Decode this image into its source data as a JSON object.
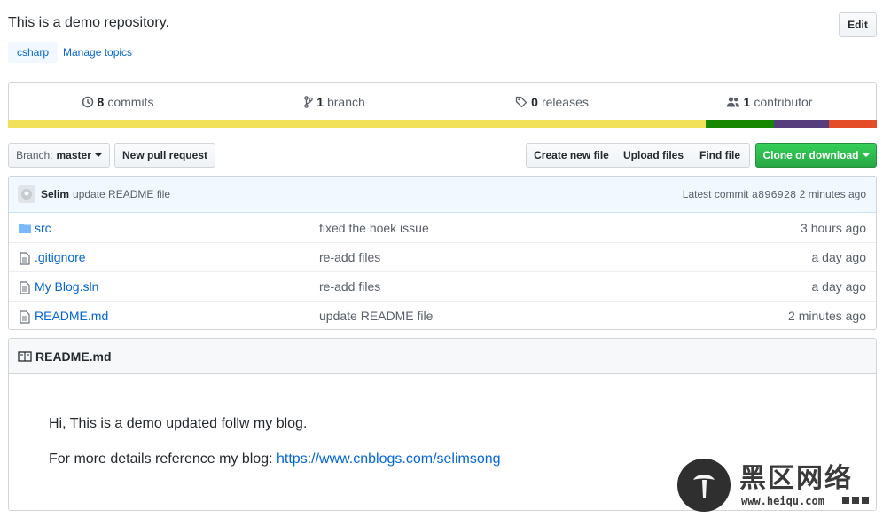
{
  "repo": {
    "description": "This is a demo repository.",
    "edit_label": "Edit",
    "topics": [
      "csharp"
    ],
    "manage_topics_label": "Manage topics"
  },
  "summary": {
    "commits": {
      "count": "8",
      "label": "commits",
      "icon": "history-icon"
    },
    "branches": {
      "count": "1",
      "label": "branch",
      "icon": "branch-icon"
    },
    "releases": {
      "count": "0",
      "label": "releases",
      "icon": "tag-icon"
    },
    "contributors": {
      "count": "1",
      "label": "contributor",
      "icon": "people-icon"
    }
  },
  "languages": [
    {
      "color": "#f1e05a",
      "percent": 80.3
    },
    {
      "color": "#178600",
      "percent": 7.9
    },
    {
      "color": "#563d7c",
      "percent": 6.3
    },
    {
      "color": "#e34c26",
      "percent": 5.5
    }
  ],
  "toolbar": {
    "branch_prefix": "Branch:",
    "branch_name": "master",
    "new_pr_label": "New pull request",
    "create_file_label": "Create new file",
    "upload_files_label": "Upload files",
    "find_file_label": "Find file",
    "clone_label": "Clone or download"
  },
  "latest_commit": {
    "author": "Selim",
    "message": "update README file",
    "prefix": "Latest commit",
    "sha": "a896928",
    "age": "2 minutes ago"
  },
  "files": [
    {
      "name": "src",
      "type": "folder",
      "message": "fixed the hoek issue",
      "age": "3 hours ago"
    },
    {
      "name": ".gitignore",
      "type": "file",
      "message": "re-add files",
      "age": "a day ago"
    },
    {
      "name": "My Blog.sln",
      "type": "file",
      "message": "re-add files",
      "age": "a day ago"
    },
    {
      "name": "README.md",
      "type": "file",
      "message": "update README file",
      "age": "2 minutes ago"
    }
  ],
  "readme": {
    "title": "README.md",
    "line1": "Hi, This is a demo updated follw my blog.",
    "line2_text": "For more details reference my blog:",
    "line2_link": "https://www.cnblogs.com/selimsong"
  },
  "watermark": {
    "text": "黑区网络",
    "url": "www.heiqu.com"
  }
}
